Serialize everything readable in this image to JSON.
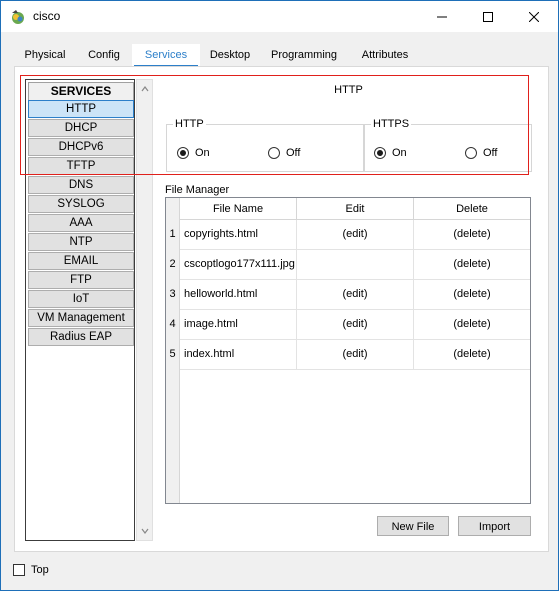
{
  "window": {
    "title": "cisco"
  },
  "tabs": [
    {
      "label": "Physical",
      "active": false
    },
    {
      "label": "Config",
      "active": false
    },
    {
      "label": "Services",
      "active": true
    },
    {
      "label": "Desktop",
      "active": false
    },
    {
      "label": "Programming",
      "active": false
    },
    {
      "label": "Attributes",
      "active": false
    }
  ],
  "services": {
    "header": "SERVICES",
    "selected": "HTTP",
    "items": [
      "HTTP",
      "DHCP",
      "DHCPv6",
      "TFTP",
      "DNS",
      "SYSLOG",
      "AAA",
      "NTP",
      "EMAIL",
      "FTP",
      "IoT",
      "VM Management",
      "Radius EAP"
    ]
  },
  "http": {
    "title": "HTTP",
    "http_group": {
      "label": "HTTP",
      "on_label": "On",
      "off_label": "Off",
      "selected": "On"
    },
    "https_group": {
      "label": "HTTPS",
      "on_label": "On",
      "off_label": "Off",
      "selected": "On"
    }
  },
  "file_manager": {
    "label": "File Manager",
    "columns": [
      "File Name",
      "Edit",
      "Delete"
    ],
    "rows": [
      {
        "num": "1",
        "name": "copyrights.html",
        "edit": "(edit)",
        "delete": "(delete)"
      },
      {
        "num": "2",
        "name": "cscoptlogo177x111.jpg",
        "edit": "",
        "delete": "(delete)"
      },
      {
        "num": "3",
        "name": "helloworld.html",
        "edit": "(edit)",
        "delete": "(delete)"
      },
      {
        "num": "4",
        "name": "image.html",
        "edit": "(edit)",
        "delete": "(delete)"
      },
      {
        "num": "5",
        "name": "index.html",
        "edit": "(edit)",
        "delete": "(delete)"
      }
    ]
  },
  "buttons": {
    "new_file": "New File",
    "import": "Import"
  },
  "footer": {
    "top_label": "Top",
    "top_checked": false
  },
  "colors": {
    "accent": "#2c7fc9",
    "highlight": "#e0201b"
  }
}
